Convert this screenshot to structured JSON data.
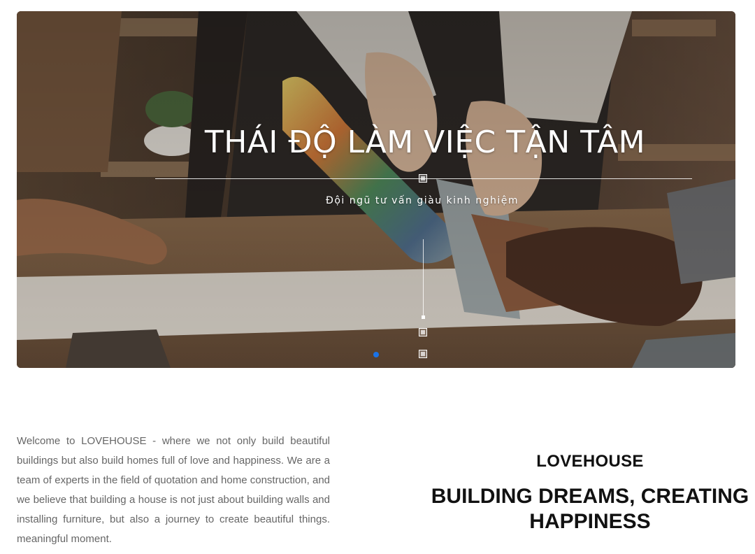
{
  "hero": {
    "title": "THÁI ĐỘ LÀM VIỆC TẬN TÂM",
    "subtitle": "Đội ngũ tư vấn giàu kinh nghiệm",
    "slide_index": 1
  },
  "intro": {
    "text": "Welcome to LOVEHOUSE - where we not only build beautiful buildings but also build homes full of love and happiness. We are a team of experts in the field of quotation and home construction, and we believe that building a house is not just about building walls and installing furniture, but also a journey to create beautiful things. meaningful moment."
  },
  "brand": {
    "name": "LOVEHOUSE",
    "headline": "BUILDING DREAMS, CREATING HAPPINESS"
  },
  "colors": {
    "accent": "#1a73e8",
    "body_text": "#666666",
    "heading_text": "#111111"
  }
}
